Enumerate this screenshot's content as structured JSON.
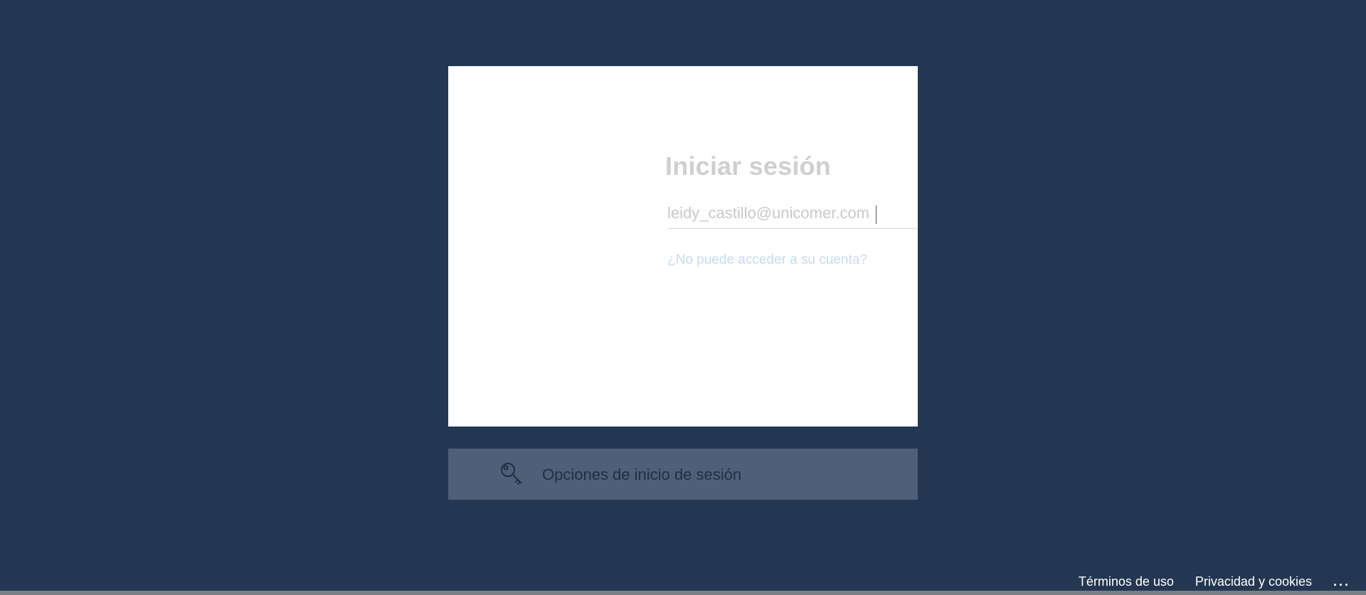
{
  "signin": {
    "title": "Iniciar sesión",
    "email_value": "leidy_castillo@unicomer.com",
    "cant_access_link": "¿No puede acceder a su cuenta?"
  },
  "options": {
    "label": "Opciones de inicio de sesión",
    "icon": "key-icon"
  },
  "footer": {
    "terms": "Términos de uso",
    "privacy": "Privacidad y cookies",
    "more": "..."
  },
  "colors": {
    "background": "#243752",
    "card": "#ffffff",
    "options_bar": "#4f5f77",
    "link": "#c5dcef"
  }
}
